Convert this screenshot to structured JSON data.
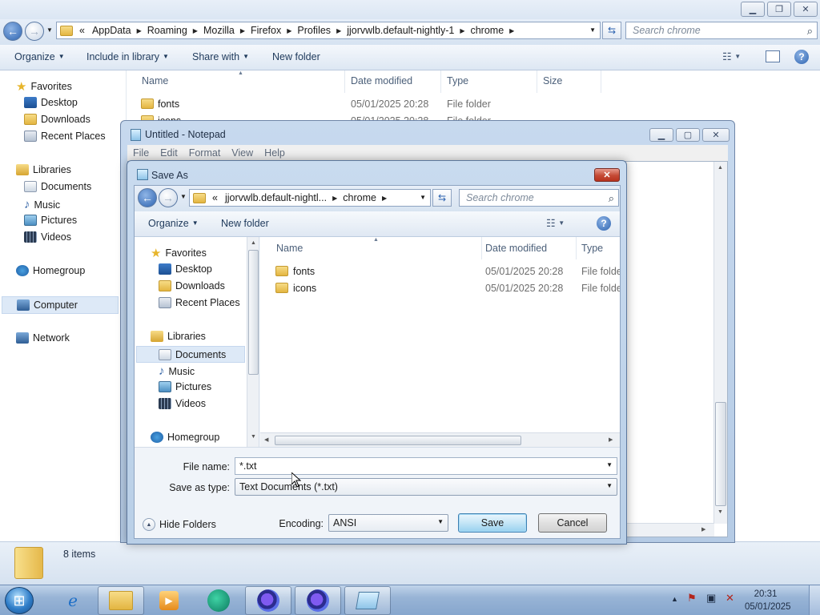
{
  "explorer": {
    "breadcrumb": [
      "AppData",
      "Roaming",
      "Mozilla",
      "Firefox",
      "Profiles",
      "jjorvwlb.default-nightly-1",
      "chrome"
    ],
    "crumb_prefix": "«",
    "search_placeholder": "Search chrome",
    "toolbar": {
      "organize": "Organize",
      "include_in_library": "Include in library",
      "share_with": "Share with",
      "new_folder": "New folder"
    },
    "nav": {
      "favorites": "Favorites",
      "desktop": "Desktop",
      "downloads": "Downloads",
      "recent_places": "Recent Places",
      "libraries": "Libraries",
      "documents": "Documents",
      "music": "Music",
      "pictures": "Pictures",
      "videos": "Videos",
      "homegroup": "Homegroup",
      "computer": "Computer",
      "network": "Network"
    },
    "columns": {
      "name": "Name",
      "date": "Date modified",
      "type": "Type",
      "size": "Size"
    },
    "rows": [
      {
        "name": "fonts",
        "date": "05/01/2025 20:28",
        "type": "File folder"
      },
      {
        "name": "icons",
        "date": "05/01/2025 20:28",
        "type": "File folder"
      }
    ],
    "status": "8 items"
  },
  "notepad": {
    "title": "Untitled - Notepad",
    "menu": [
      "File",
      "Edit",
      "Format",
      "View",
      "Help"
    ]
  },
  "saveas": {
    "title": "Save As",
    "breadcrumb": [
      "jjorvwlb.default-nightl...",
      "chrome"
    ],
    "crumb_prefix": "«",
    "search_placeholder": "Search chrome",
    "toolbar": {
      "organize": "Organize",
      "new_folder": "New folder"
    },
    "nav": {
      "favorites": "Favorites",
      "desktop": "Desktop",
      "downloads": "Downloads",
      "recent_places": "Recent Places",
      "libraries": "Libraries",
      "documents": "Documents",
      "music": "Music",
      "pictures": "Pictures",
      "videos": "Videos",
      "homegroup": "Homegroup"
    },
    "columns": {
      "name": "Name",
      "date": "Date modified",
      "type": "Type"
    },
    "rows": [
      {
        "name": "fonts",
        "date": "05/01/2025 20:28",
        "type": "File folder"
      },
      {
        "name": "icons",
        "date": "05/01/2025 20:28",
        "type": "File folder"
      }
    ],
    "file_name_label": "File name:",
    "file_name_value": "*.txt",
    "save_as_type_label": "Save as type:",
    "save_as_type_value": "Text Documents (*.txt)",
    "hide_folders": "Hide Folders",
    "encoding_label": "Encoding:",
    "encoding_value": "ANSI",
    "save_button": "Save",
    "cancel_button": "Cancel"
  },
  "taskbar": {
    "time": "20:31",
    "date": "05/01/2025"
  },
  "colors": {
    "accent": "#2d63b0",
    "folder": "#e3b541",
    "close_red": "#c44a35"
  }
}
